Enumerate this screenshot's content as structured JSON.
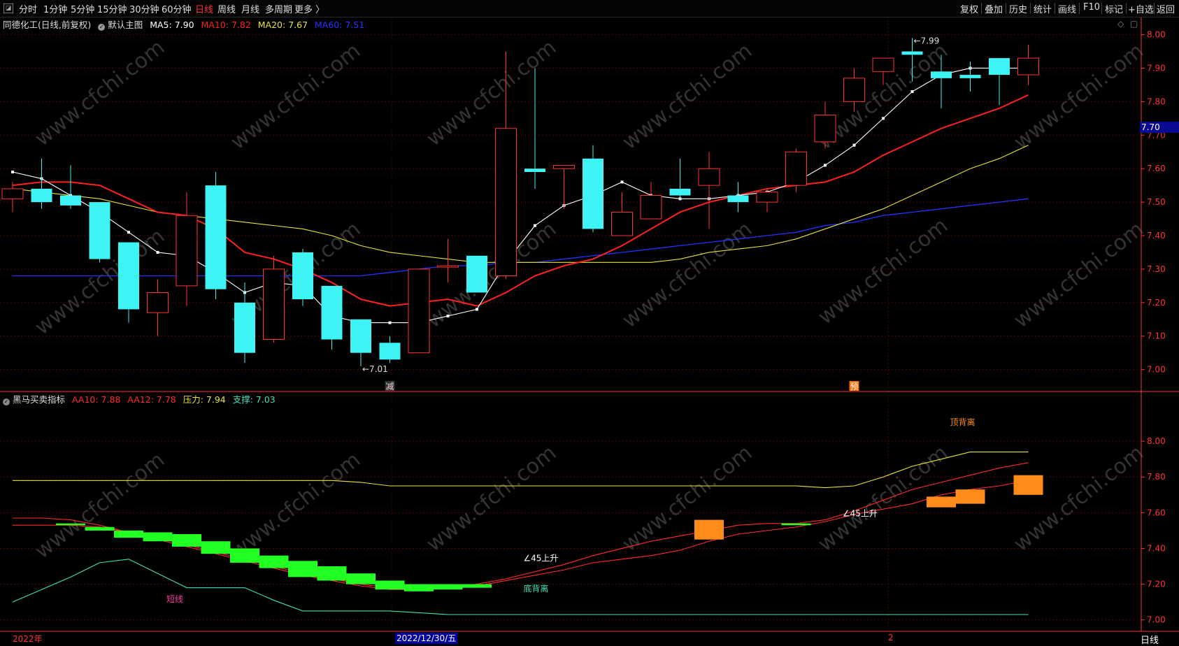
{
  "toolbar": {
    "collapse_glyph": "◪",
    "periods": [
      "分时",
      "1分钟",
      "5分钟",
      "15分钟",
      "30分钟",
      "60分钟",
      "日线",
      "周线",
      "月线",
      "多周期",
      "更多 〉"
    ],
    "active_period": "日线",
    "right_buttons": [
      "复权",
      "叠加",
      "历史",
      "统计",
      "画线",
      "F10",
      "标记",
      "+自选",
      "返回"
    ]
  },
  "main_chart": {
    "stock_title": "同德化工(日线,前复权)",
    "template_label": "默认主图",
    "ma": [
      {
        "label": "MA5: 7.90",
        "color": "#ffffff"
      },
      {
        "label": "MA10: 7.82",
        "color": "#ff2020"
      },
      {
        "label": "MA20: 7.67",
        "color": "#e8e23a"
      },
      {
        "label": "MA60: 7.51",
        "color": "#2233ff"
      }
    ],
    "current_price_tag": "7.70",
    "y_axis": {
      "min": 6.97,
      "max": 8.02,
      "ticks": [
        "8.00",
        "7.90",
        "7.80",
        "7.70",
        "7.60",
        "7.50",
        "7.40",
        "7.30",
        "7.20",
        "7.10",
        "7.00"
      ]
    },
    "high_annotation": "7.99",
    "low_annotation": "7.01",
    "signals": [
      {
        "text": "减",
        "index": 13,
        "color": "#ffc0e0",
        "bg": "#2a3a2a"
      },
      {
        "text": "预",
        "index": 29,
        "color": "#ffffff",
        "bg": "#ff6a00"
      }
    ],
    "candles": [
      {
        "o": 7.51,
        "h": 7.56,
        "l": 7.47,
        "c": 7.54
      },
      {
        "o": 7.54,
        "h": 7.63,
        "l": 7.48,
        "c": 7.5
      },
      {
        "o": 7.52,
        "h": 7.61,
        "l": 7.48,
        "c": 7.49
      },
      {
        "o": 7.5,
        "h": 7.5,
        "l": 7.32,
        "c": 7.33
      },
      {
        "o": 7.38,
        "h": 7.38,
        "l": 7.14,
        "c": 7.18
      },
      {
        "o": 7.17,
        "h": 7.27,
        "l": 7.1,
        "c": 7.23
      },
      {
        "o": 7.25,
        "h": 7.53,
        "l": 7.19,
        "c": 7.46
      },
      {
        "o": 7.55,
        "h": 7.59,
        "l": 7.21,
        "c": 7.24
      },
      {
        "o": 7.2,
        "h": 7.26,
        "l": 7.02,
        "c": 7.05
      },
      {
        "o": 7.09,
        "h": 7.34,
        "l": 7.08,
        "c": 7.3
      },
      {
        "o": 7.35,
        "h": 7.36,
        "l": 7.19,
        "c": 7.21
      },
      {
        "o": 7.25,
        "h": 7.25,
        "l": 7.06,
        "c": 7.09
      },
      {
        "o": 7.15,
        "h": 7.15,
        "l": 7.01,
        "c": 7.05
      },
      {
        "o": 7.08,
        "h": 7.1,
        "l": 7.02,
        "c": 7.03
      },
      {
        "o": 7.05,
        "h": 7.3,
        "l": 7.05,
        "c": 7.3
      },
      {
        "o": 7.31,
        "h": 7.39,
        "l": 7.26,
        "c": 7.31
      },
      {
        "o": 7.34,
        "h": 7.34,
        "l": 7.23,
        "c": 7.23
      },
      {
        "o": 7.28,
        "h": 7.95,
        "l": 7.27,
        "c": 7.72
      },
      {
        "o": 7.6,
        "h": 7.9,
        "l": 7.54,
        "c": 7.59
      },
      {
        "o": 7.6,
        "h": 7.61,
        "l": 7.48,
        "c": 7.61
      },
      {
        "o": 7.63,
        "h": 7.67,
        "l": 7.41,
        "c": 7.42
      },
      {
        "o": 7.4,
        "h": 7.53,
        "l": 7.4,
        "c": 7.47
      },
      {
        "o": 7.45,
        "h": 7.56,
        "l": 7.45,
        "c": 7.52
      },
      {
        "o": 7.54,
        "h": 7.63,
        "l": 7.51,
        "c": 7.52
      },
      {
        "o": 7.55,
        "h": 7.65,
        "l": 7.42,
        "c": 7.6
      },
      {
        "o": 7.52,
        "h": 7.56,
        "l": 7.47,
        "c": 7.5
      },
      {
        "o": 7.5,
        "h": 7.54,
        "l": 7.47,
        "c": 7.53
      },
      {
        "o": 7.55,
        "h": 7.66,
        "l": 7.53,
        "c": 7.65
      },
      {
        "o": 7.68,
        "h": 7.8,
        "l": 7.66,
        "c": 7.76
      },
      {
        "o": 7.8,
        "h": 7.9,
        "l": 7.77,
        "c": 7.87
      },
      {
        "o": 7.89,
        "h": 7.93,
        "l": 7.85,
        "c": 7.93
      },
      {
        "o": 7.95,
        "h": 7.99,
        "l": 7.86,
        "c": 7.94
      },
      {
        "o": 7.89,
        "h": 7.94,
        "l": 7.78,
        "c": 7.87
      },
      {
        "o": 7.88,
        "h": 7.92,
        "l": 7.83,
        "c": 7.87
      },
      {
        "o": 7.93,
        "h": 7.93,
        "l": 7.79,
        "c": 7.88
      },
      {
        "o": 7.88,
        "h": 7.97,
        "l": 7.85,
        "c": 7.93
      }
    ],
    "ma5": [
      7.59,
      7.57,
      7.52,
      7.47,
      7.41,
      7.35,
      7.34,
      7.29,
      7.23,
      7.26,
      7.25,
      7.16,
      7.14,
      7.14,
      7.14,
      7.16,
      7.18,
      7.32,
      7.43,
      7.49,
      7.52,
      7.56,
      7.52,
      7.51,
      7.51,
      7.52,
      7.53,
      7.56,
      7.61,
      7.67,
      7.75,
      7.83,
      7.88,
      7.9,
      7.9,
      7.9
    ],
    "ma10": [
      7.55,
      7.56,
      7.56,
      7.55,
      7.51,
      7.47,
      7.46,
      7.42,
      7.35,
      7.33,
      7.3,
      7.26,
      7.21,
      7.19,
      7.2,
      7.21,
      7.19,
      7.23,
      7.28,
      7.31,
      7.33,
      7.37,
      7.42,
      7.47,
      7.5,
      7.52,
      7.54,
      7.55,
      7.56,
      7.59,
      7.64,
      7.68,
      7.72,
      7.75,
      7.78,
      7.82
    ],
    "ma20": [
      7.54,
      7.53,
      7.52,
      7.51,
      7.49,
      7.47,
      7.46,
      7.45,
      7.44,
      7.43,
      7.42,
      7.4,
      7.37,
      7.35,
      7.34,
      7.33,
      7.32,
      7.32,
      7.32,
      7.32,
      7.32,
      7.32,
      7.32,
      7.33,
      7.35,
      7.36,
      7.37,
      7.39,
      7.42,
      7.45,
      7.48,
      7.52,
      7.56,
      7.6,
      7.63,
      7.67
    ],
    "ma60": [
      7.28,
      7.28,
      7.28,
      7.28,
      7.28,
      7.28,
      7.28,
      7.28,
      7.28,
      7.28,
      7.28,
      7.28,
      7.28,
      7.29,
      7.3,
      7.31,
      7.31,
      7.32,
      7.32,
      7.33,
      7.34,
      7.35,
      7.36,
      7.37,
      7.38,
      7.39,
      7.4,
      7.41,
      7.43,
      7.44,
      7.46,
      7.47,
      7.48,
      7.49,
      7.5,
      7.51
    ]
  },
  "indicator": {
    "name": "黑马买卖指标",
    "values": [
      {
        "label": "AA10: 7.88",
        "color": "#ff2a2a"
      },
      {
        "label": "AA12: 7.78",
        "color": "#ff2a2a"
      },
      {
        "label": "压力: 7.94",
        "color": "#e8e23a"
      },
      {
        "label": "支撑: 7.03",
        "color": "#3fe0b8"
      }
    ],
    "y_axis": {
      "min": 6.94,
      "max": 8.2,
      "ticks": [
        "8.00",
        "7.80",
        "7.60",
        "7.40",
        "7.20",
        "7.00"
      ]
    },
    "labels": [
      {
        "text": "顶背离",
        "index": 32.3,
        "value": 8.09,
        "color": "#ff8c1a"
      },
      {
        "text": "底背离",
        "index": 17.6,
        "value": 7.16,
        "color": "#3fe0b8"
      },
      {
        "text": "∠45上升",
        "index": 17.6,
        "value": 7.33,
        "color": "#ffffff"
      },
      {
        "text": "∠45上升",
        "index": 28.6,
        "value": 7.58,
        "color": "#ffffff"
      },
      {
        "text": "短线",
        "index": 5.3,
        "value": 7.1,
        "color": "#ff3aa0"
      }
    ],
    "aa10": [
      7.57,
      7.57,
      7.56,
      7.53,
      7.49,
      7.45,
      7.41,
      7.37,
      7.33,
      7.29,
      7.25,
      7.22,
      7.19,
      7.17,
      7.17,
      7.18,
      7.2,
      7.23,
      7.27,
      7.31,
      7.36,
      7.4,
      7.44,
      7.47,
      7.5,
      7.53,
      7.54,
      7.54,
      7.56,
      7.61,
      7.67,
      7.73,
      7.77,
      7.81,
      7.85,
      7.88
    ],
    "aa12": [
      7.53,
      7.53,
      7.53,
      7.52,
      7.49,
      7.46,
      7.42,
      7.38,
      7.34,
      7.3,
      7.26,
      7.23,
      7.2,
      7.18,
      7.17,
      7.18,
      7.19,
      7.22,
      7.25,
      7.28,
      7.32,
      7.34,
      7.36,
      7.39,
      7.44,
      7.48,
      7.5,
      7.52,
      7.55,
      7.59,
      7.62,
      7.65,
      7.7,
      7.73,
      7.75,
      7.78
    ],
    "press": [
      7.78,
      7.78,
      7.78,
      7.78,
      7.78,
      7.78,
      7.78,
      7.78,
      7.78,
      7.78,
      7.78,
      7.78,
      7.77,
      7.75,
      7.75,
      7.75,
      7.75,
      7.75,
      7.75,
      7.75,
      7.75,
      7.75,
      7.75,
      7.75,
      7.75,
      7.75,
      7.75,
      7.75,
      7.74,
      7.75,
      7.8,
      7.86,
      7.9,
      7.94,
      7.94,
      7.94
    ],
    "supp": [
      7.1,
      7.17,
      7.24,
      7.32,
      7.34,
      7.26,
      7.18,
      7.18,
      7.18,
      7.11,
      7.05,
      7.05,
      7.05,
      7.05,
      7.04,
      7.03,
      7.03,
      7.03,
      7.03,
      7.03,
      7.03,
      7.03,
      7.03,
      7.03,
      7.03,
      7.03,
      7.03,
      7.03,
      7.03,
      7.03,
      7.03,
      7.03,
      7.03,
      7.03,
      7.03,
      7.03
    ],
    "green_bars": [
      [
        2,
        7.54,
        7.53
      ],
      [
        3,
        7.52,
        7.5
      ],
      [
        4,
        7.5,
        7.46
      ],
      [
        5,
        7.49,
        7.44
      ],
      [
        6,
        7.48,
        7.41
      ],
      [
        7,
        7.44,
        7.37
      ],
      [
        8,
        7.4,
        7.32
      ],
      [
        9,
        7.36,
        7.29
      ],
      [
        10,
        7.33,
        7.24
      ],
      [
        11,
        7.3,
        7.22
      ],
      [
        12,
        7.26,
        7.2
      ],
      [
        13,
        7.22,
        7.17
      ],
      [
        14,
        7.2,
        7.16
      ],
      [
        15,
        7.2,
        7.17
      ],
      [
        16,
        7.2,
        7.18
      ],
      [
        27,
        7.54,
        7.53
      ]
    ],
    "orange_bars": [
      [
        24,
        7.56,
        7.45
      ],
      [
        32,
        7.69,
        7.63
      ],
      [
        33,
        7.73,
        7.65
      ],
      [
        35,
        7.81,
        7.7
      ]
    ]
  },
  "status_bar": {
    "year": "2022年",
    "date": "2022/12/30/五",
    "tick": "2",
    "period": "日线"
  },
  "colors": {
    "up": "#ff3232",
    "down": "#3df3f3",
    "grid": "#5a0000",
    "axis_text": "#ff3232",
    "watermark": "#333333"
  },
  "watermark": "www.cfchi.com"
}
